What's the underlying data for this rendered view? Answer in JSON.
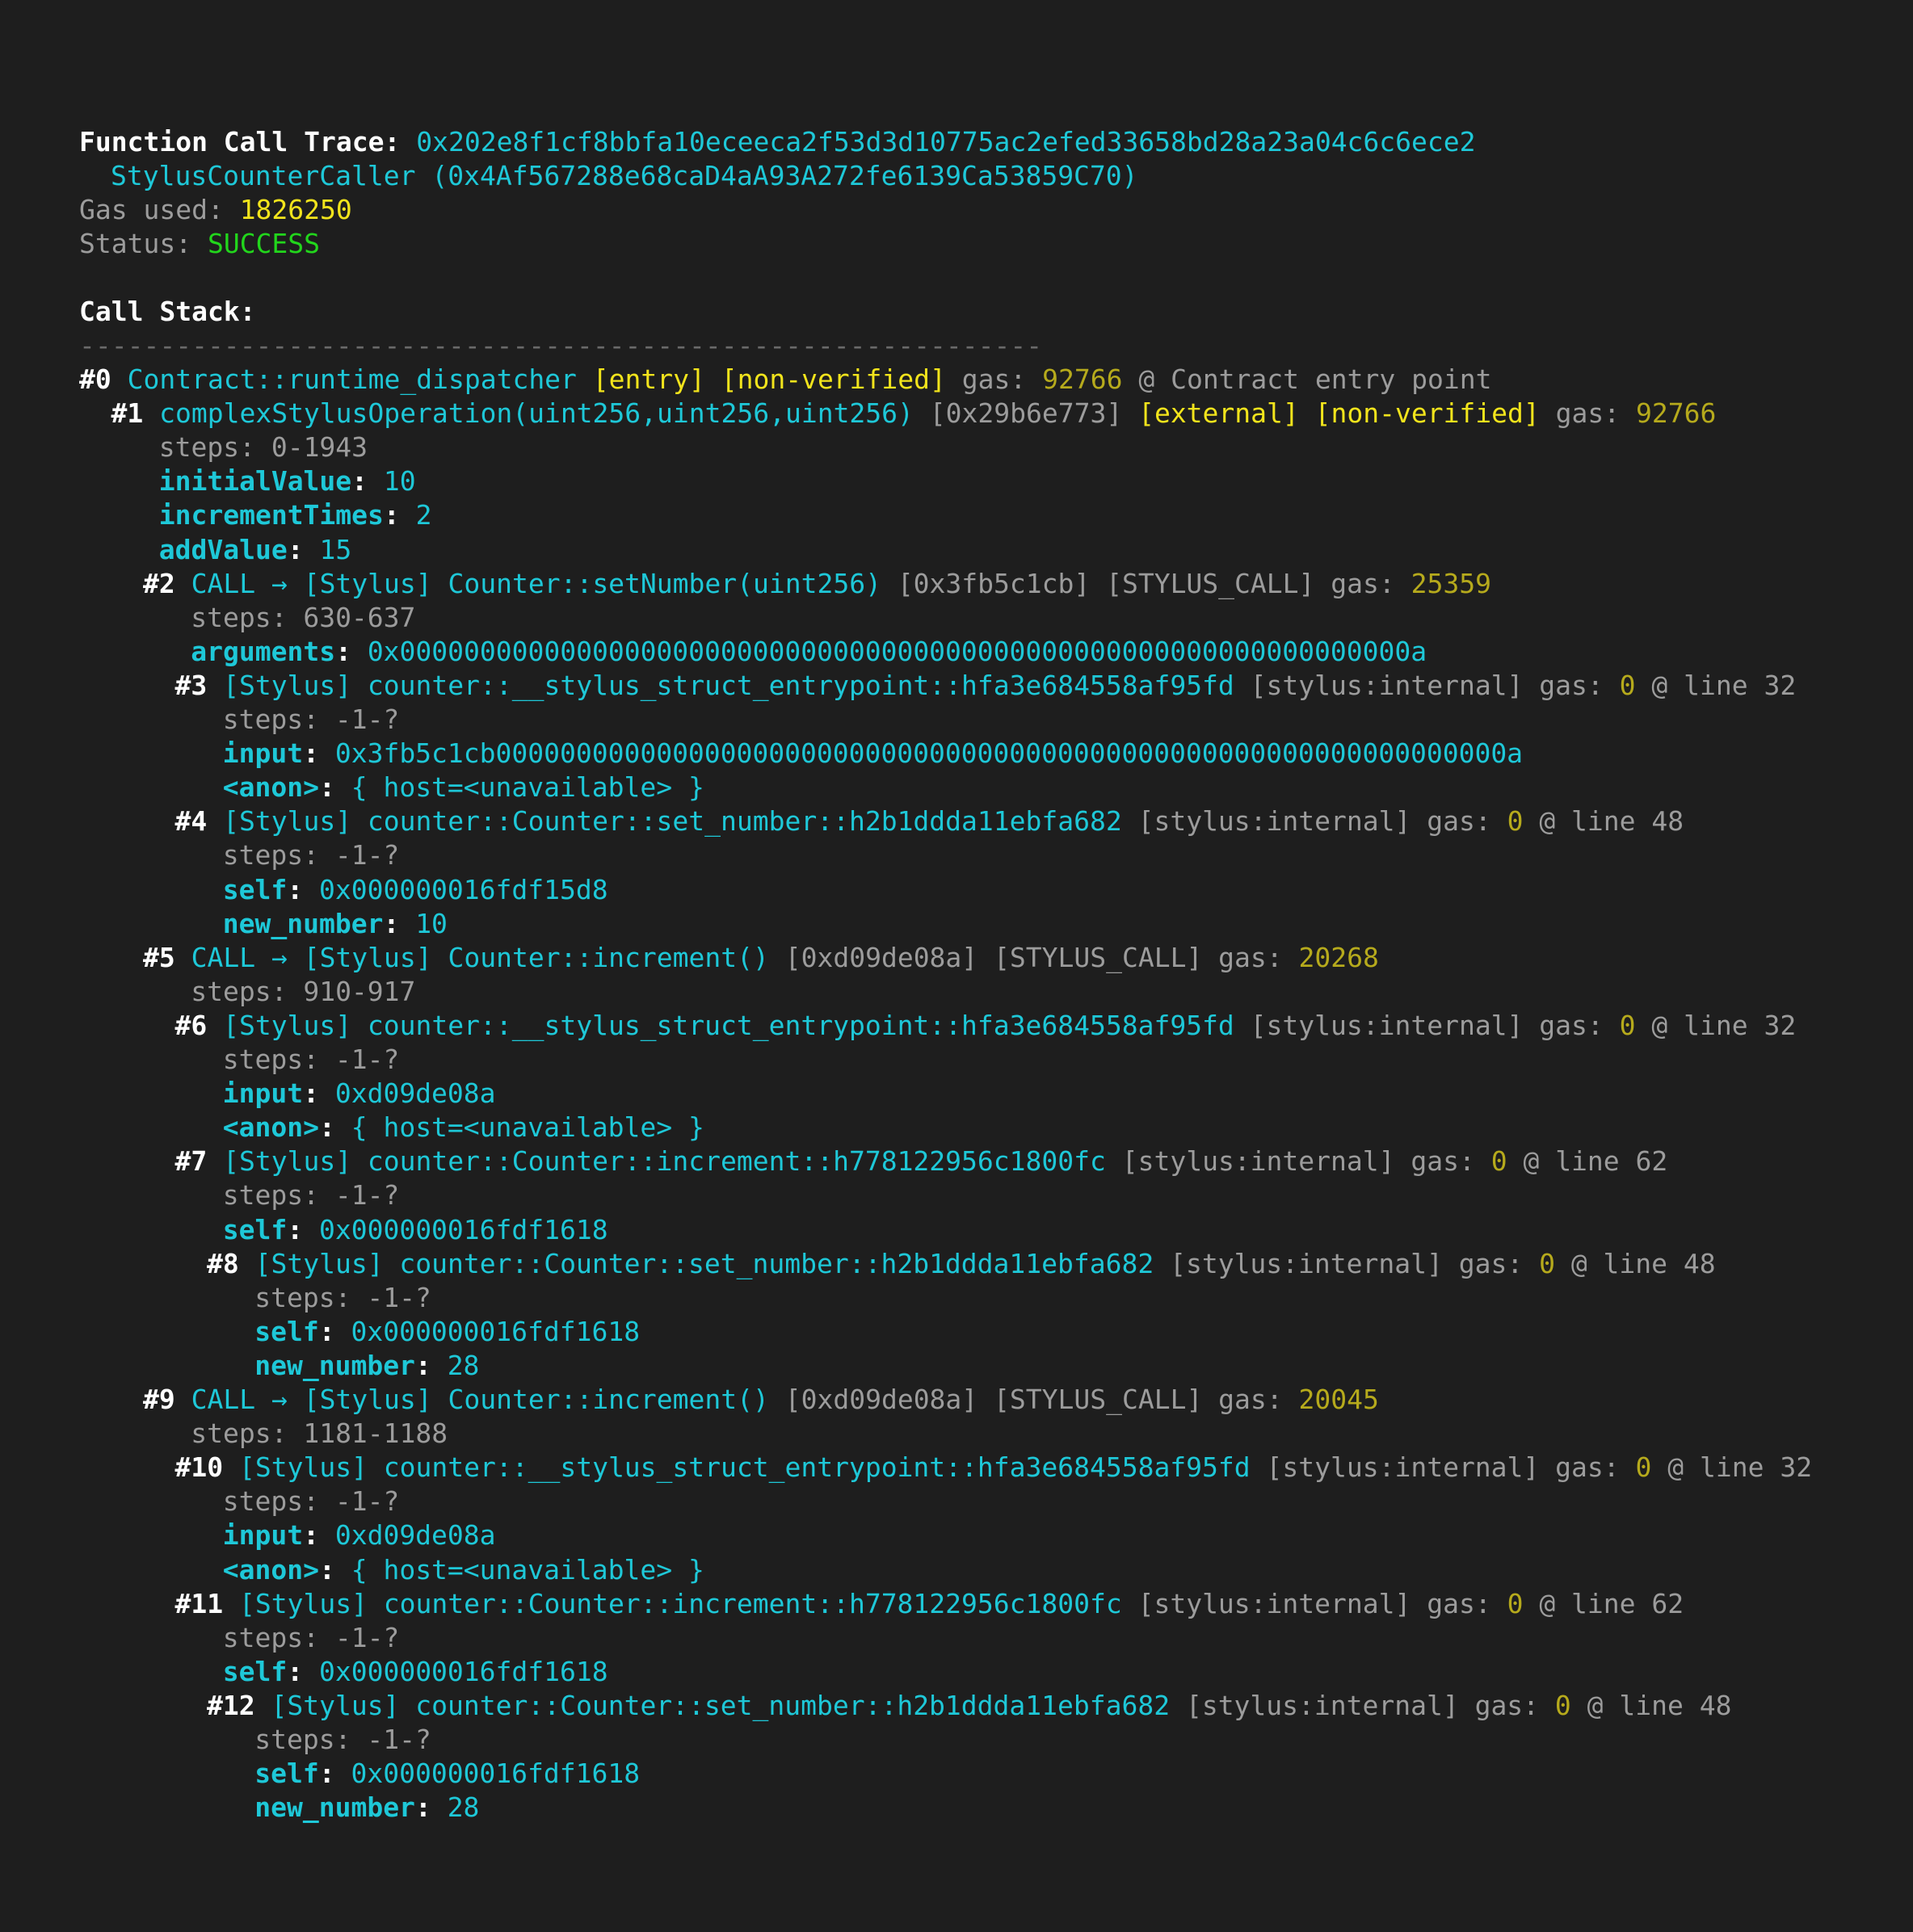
{
  "header": {
    "title_label": "Function Call Trace:",
    "tx_hash": "0x202e8f1cf8bbfa10eceeca2f53d3d10775ac2efed33658bd28a23a04c6c6ece2",
    "contract": "StylusCounterCaller (0x4Af567288e68caD4aA93A272fe6139Ca53859C70)",
    "gas_label": "Gas used:",
    "gas_value": "1826250",
    "status_label": "Status:",
    "status_value": "SUCCESS"
  },
  "stack": {
    "title": "Call Stack:",
    "separator": "------------------------------------------------------------"
  },
  "colors": {
    "background": "#1e1e1e",
    "cyan": "#1ec8d8",
    "yellow": "#f2e41c",
    "olive": "#b6aa1c",
    "green": "#22d61c",
    "gray": "#9c9c9c"
  },
  "frames": [
    {
      "id": "#0",
      "ind": 0,
      "p": [
        {
          "k": "c",
          "t": "Contract::runtime_dispatcher"
        },
        {
          "k": "y",
          "t": "[entry] [non-verified]"
        },
        {
          "k": "g",
          "t": "gas:"
        },
        {
          "k": "o",
          "t": "92766"
        },
        {
          "k": "g",
          "t": "@ Contract entry point"
        }
      ]
    },
    {
      "id": "#1",
      "ind": 1,
      "p": [
        {
          "k": "c",
          "t": "complexStylusOperation(uint256,uint256,uint256)"
        },
        {
          "k": "g",
          "t": "[0x29b6e773]"
        },
        {
          "k": "y",
          "t": "[external] [non-verified]"
        },
        {
          "k": "g",
          "t": "gas:"
        },
        {
          "k": "o",
          "t": "92766"
        }
      ],
      "attrs": [
        {
          "steps": "0-1943"
        },
        {
          "n": "initialValue",
          "v": "10"
        },
        {
          "n": "incrementTimes",
          "v": "2"
        },
        {
          "n": "addValue",
          "v": "15"
        }
      ]
    },
    {
      "id": "#2",
      "ind": 2,
      "p": [
        {
          "k": "c",
          "t": "CALL → [Stylus] Counter::setNumber(uint256)"
        },
        {
          "k": "g",
          "t": "[0x3fb5c1cb] [STYLUS_CALL] gas:"
        },
        {
          "k": "o",
          "t": "25359"
        }
      ],
      "attrs": [
        {
          "steps": "630-637"
        },
        {
          "n": "arguments",
          "v": "0x000000000000000000000000000000000000000000000000000000000000000a"
        }
      ]
    },
    {
      "id": "#3",
      "ind": 3,
      "p": [
        {
          "k": "c",
          "t": "[Stylus] counter::__stylus_struct_entrypoint::hfa3e684558af95fd"
        },
        {
          "k": "g",
          "t": "[stylus:internal] gas:"
        },
        {
          "k": "o",
          "t": "0"
        },
        {
          "k": "g",
          "t": "@ line 32"
        }
      ],
      "attrs": [
        {
          "steps": "-1-?"
        },
        {
          "n": "input",
          "v": "0x3fb5c1cb000000000000000000000000000000000000000000000000000000000000000a"
        },
        {
          "n": "<anon>",
          "v": "{ host=<unavailable> }"
        }
      ]
    },
    {
      "id": "#4",
      "ind": 3,
      "p": [
        {
          "k": "c",
          "t": "[Stylus] counter::Counter::set_number::h2b1ddda11ebfa682"
        },
        {
          "k": "g",
          "t": "[stylus:internal] gas:"
        },
        {
          "k": "o",
          "t": "0"
        },
        {
          "k": "g",
          "t": "@ line 48"
        }
      ],
      "attrs": [
        {
          "steps": "-1-?"
        },
        {
          "n": "self",
          "v": "0x000000016fdf15d8"
        },
        {
          "n": "new_number",
          "v": "10"
        }
      ]
    },
    {
      "id": "#5",
      "ind": 2,
      "p": [
        {
          "k": "c",
          "t": "CALL → [Stylus] Counter::increment()"
        },
        {
          "k": "g",
          "t": "[0xd09de08a] [STYLUS_CALL] gas:"
        },
        {
          "k": "o",
          "t": "20268"
        }
      ],
      "attrs": [
        {
          "steps": "910-917"
        }
      ]
    },
    {
      "id": "#6",
      "ind": 3,
      "p": [
        {
          "k": "c",
          "t": "[Stylus] counter::__stylus_struct_entrypoint::hfa3e684558af95fd"
        },
        {
          "k": "g",
          "t": "[stylus:internal] gas:"
        },
        {
          "k": "o",
          "t": "0"
        },
        {
          "k": "g",
          "t": "@ line 32"
        }
      ],
      "attrs": [
        {
          "steps": "-1-?"
        },
        {
          "n": "input",
          "v": "0xd09de08a"
        },
        {
          "n": "<anon>",
          "v": "{ host=<unavailable> }"
        }
      ]
    },
    {
      "id": "#7",
      "ind": 3,
      "p": [
        {
          "k": "c",
          "t": "[Stylus] counter::Counter::increment::h778122956c1800fc"
        },
        {
          "k": "g",
          "t": "[stylus:internal] gas:"
        },
        {
          "k": "o",
          "t": "0"
        },
        {
          "k": "g",
          "t": "@ line 62"
        }
      ],
      "attrs": [
        {
          "steps": "-1-?"
        },
        {
          "n": "self",
          "v": "0x000000016fdf1618"
        }
      ]
    },
    {
      "id": "#8",
      "ind": 4,
      "p": [
        {
          "k": "c",
          "t": "[Stylus] counter::Counter::set_number::h2b1ddda11ebfa682"
        },
        {
          "k": "g",
          "t": "[stylus:internal] gas:"
        },
        {
          "k": "o",
          "t": "0"
        },
        {
          "k": "g",
          "t": "@ line 48"
        }
      ],
      "attrs": [
        {
          "steps": "-1-?"
        },
        {
          "n": "self",
          "v": "0x000000016fdf1618"
        },
        {
          "n": "new_number",
          "v": "28"
        }
      ]
    },
    {
      "id": "#9",
      "ind": 2,
      "p": [
        {
          "k": "c",
          "t": "CALL → [Stylus] Counter::increment()"
        },
        {
          "k": "g",
          "t": "[0xd09de08a] [STYLUS_CALL] gas:"
        },
        {
          "k": "o",
          "t": "20045"
        }
      ],
      "attrs": [
        {
          "steps": "1181-1188"
        }
      ]
    },
    {
      "id": "#10",
      "ind": 3,
      "p": [
        {
          "k": "c",
          "t": "[Stylus] counter::__stylus_struct_entrypoint::hfa3e684558af95fd"
        },
        {
          "k": "g",
          "t": "[stylus:internal] gas:"
        },
        {
          "k": "o",
          "t": "0"
        },
        {
          "k": "g",
          "t": "@ line 32"
        }
      ],
      "attrs": [
        {
          "steps": "-1-?"
        },
        {
          "n": "input",
          "v": "0xd09de08a"
        },
        {
          "n": "<anon>",
          "v": "{ host=<unavailable> }"
        }
      ]
    },
    {
      "id": "#11",
      "ind": 3,
      "p": [
        {
          "k": "c",
          "t": "[Stylus] counter::Counter::increment::h778122956c1800fc"
        },
        {
          "k": "g",
          "t": "[stylus:internal] gas:"
        },
        {
          "k": "o",
          "t": "0"
        },
        {
          "k": "g",
          "t": "@ line 62"
        }
      ],
      "attrs": [
        {
          "steps": "-1-?"
        },
        {
          "n": "self",
          "v": "0x000000016fdf1618"
        }
      ]
    },
    {
      "id": "#12",
      "ind": 4,
      "p": [
        {
          "k": "c",
          "t": "[Stylus] counter::Counter::set_number::h2b1ddda11ebfa682"
        },
        {
          "k": "g",
          "t": "[stylus:internal] gas:"
        },
        {
          "k": "o",
          "t": "0"
        },
        {
          "k": "g",
          "t": "@ line 48"
        }
      ],
      "attrs": [
        {
          "steps": "-1-?"
        },
        {
          "n": "self",
          "v": "0x000000016fdf1618"
        },
        {
          "n": "new_number",
          "v": "28"
        }
      ]
    }
  ]
}
